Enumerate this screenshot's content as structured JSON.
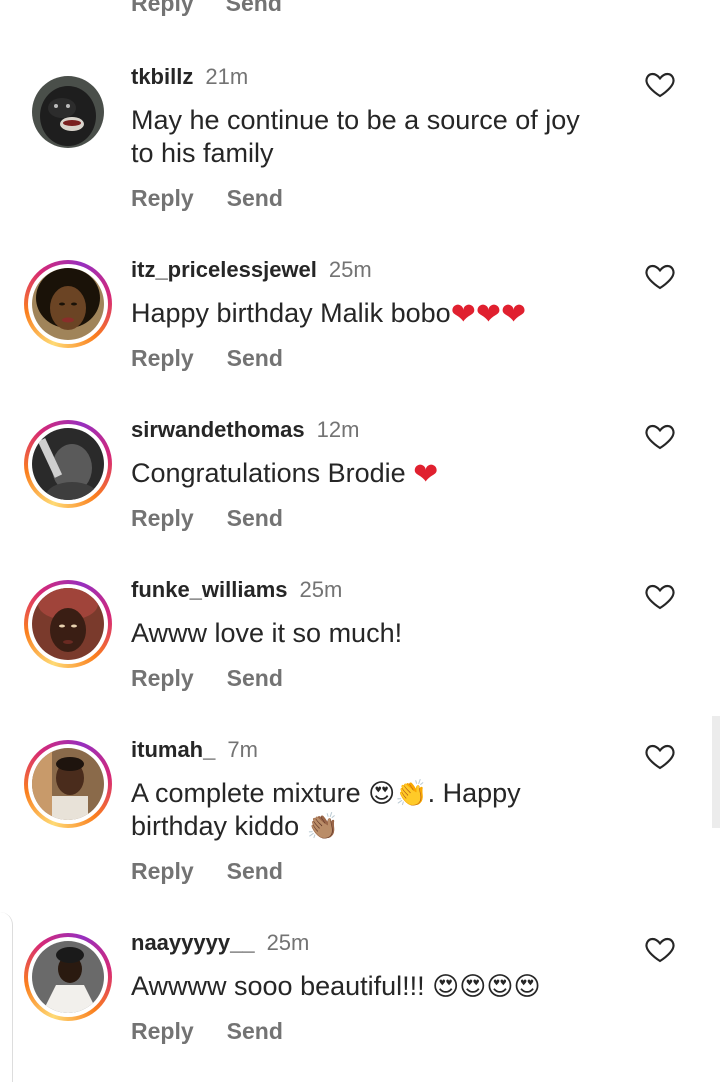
{
  "top_partial": {
    "reply_label": "Reply",
    "send_label": "Send"
  },
  "comments": [
    {
      "username": "tkbillz",
      "time": "21m",
      "text_line1": "May he continue to be a source of joy",
      "text_line2": "to his family",
      "reply_label": "Reply",
      "send_label": "Send",
      "story_ring": false
    },
    {
      "username": "itz_pricelessjewel",
      "time": "25m",
      "text": "Happy birthday Malik bobo",
      "trailing_emoji": "❤❤❤",
      "reply_label": "Reply",
      "send_label": "Send",
      "story_ring": true
    },
    {
      "username": "sirwandethomas",
      "time": "12m",
      "text": "Congratulations Brodie ",
      "trailing_emoji": "❤",
      "reply_label": "Reply",
      "send_label": "Send",
      "story_ring": true
    },
    {
      "username": "funke_williams",
      "time": "25m",
      "text": "Awww love it so much!",
      "reply_label": "Reply",
      "send_label": "Send",
      "story_ring": true
    },
    {
      "username": "itumah_",
      "time": "7m",
      "text_line1_a": "A complete mixture ",
      "text_line1_emoji": "😍👏",
      "text_line1_b": ". Happy",
      "text_line2_a": "birthday kiddo ",
      "text_line2_emoji": "👏🏽",
      "reply_label": "Reply",
      "send_label": "Send",
      "story_ring": true
    },
    {
      "username": "naayyyyy__",
      "time": "25m",
      "text": "Awwww sooo beautiful!!! ",
      "trailing_emoji": "😍😍😍😍",
      "reply_label": "Reply",
      "send_label": "Send",
      "story_ring": true
    }
  ],
  "colors": {
    "text_primary": "#262626",
    "text_secondary": "#737373",
    "heart_red": "#e0202f",
    "story_ring_gradient": [
      "#feda75",
      "#fa7e1e",
      "#d62976",
      "#962fbf"
    ]
  },
  "icons": {
    "like": "heart-outline-icon"
  }
}
